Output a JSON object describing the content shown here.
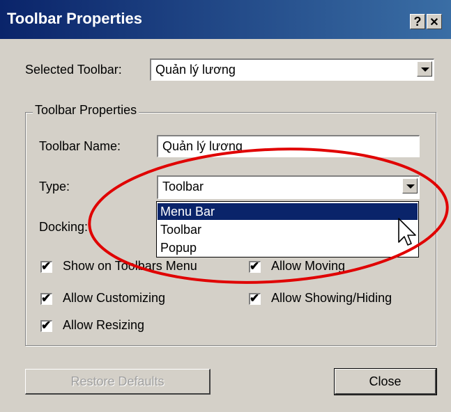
{
  "window": {
    "title": "Toolbar Properties",
    "help_glyph": "?",
    "close_glyph": "✕"
  },
  "selected_toolbar": {
    "label": "Selected Toolbar:",
    "value": "Quản lý lương"
  },
  "group": {
    "label": "Toolbar Properties",
    "toolbar_name_label": "Toolbar Name:",
    "toolbar_name_value": "Quản lý lương",
    "type_label": "Type:",
    "type_value": "Toolbar",
    "docking_label": "Docking:",
    "type_options": [
      "Menu Bar",
      "Toolbar",
      "Popup"
    ],
    "highlighted_option": "Menu Bar"
  },
  "checkboxes": {
    "show_on_toolbars_menu": {
      "label": "Show on Toolbars Menu",
      "checked": true
    },
    "allow_moving": {
      "label": "Allow Moving",
      "checked": true
    },
    "allow_customizing": {
      "label": "Allow Customizing",
      "checked": true
    },
    "allow_showing_hiding": {
      "label": "Allow Showing/Hiding",
      "checked": true
    },
    "allow_resizing": {
      "label": "Allow Resizing",
      "checked": true
    }
  },
  "check_glyph": "✔",
  "buttons": {
    "restore_defaults": "Restore Defaults",
    "close": "Close"
  },
  "annotation_color": "#e00000",
  "title_bar_color": "#0a246a",
  "dialog_color": "#d4d0c8"
}
